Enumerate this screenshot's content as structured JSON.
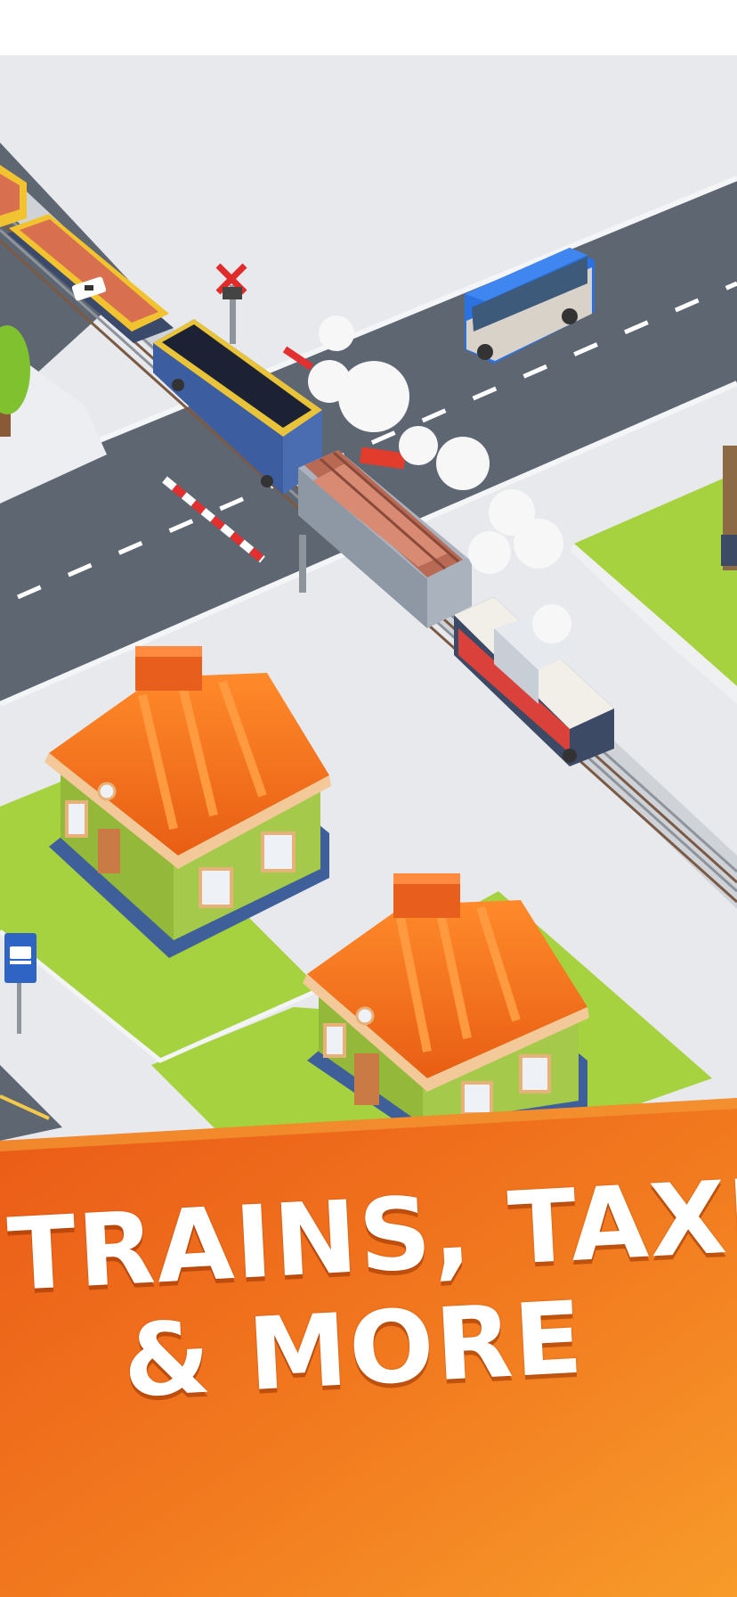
{
  "banner": {
    "line1": "TRAINS, TAXIS",
    "line2": "& MORE"
  },
  "colors": {
    "banner_orange": "#f06a1c",
    "banner_yellow": "#f6a12a",
    "road": "#5d6570",
    "pavement": "#e7e8ec",
    "grass": "#a6d23f",
    "roof": "#f26a1b",
    "house_wall": "#93b83a",
    "bus": "#2b72e0"
  },
  "icons": [
    "bus-stop-sign-icon",
    "lock-icon"
  ]
}
